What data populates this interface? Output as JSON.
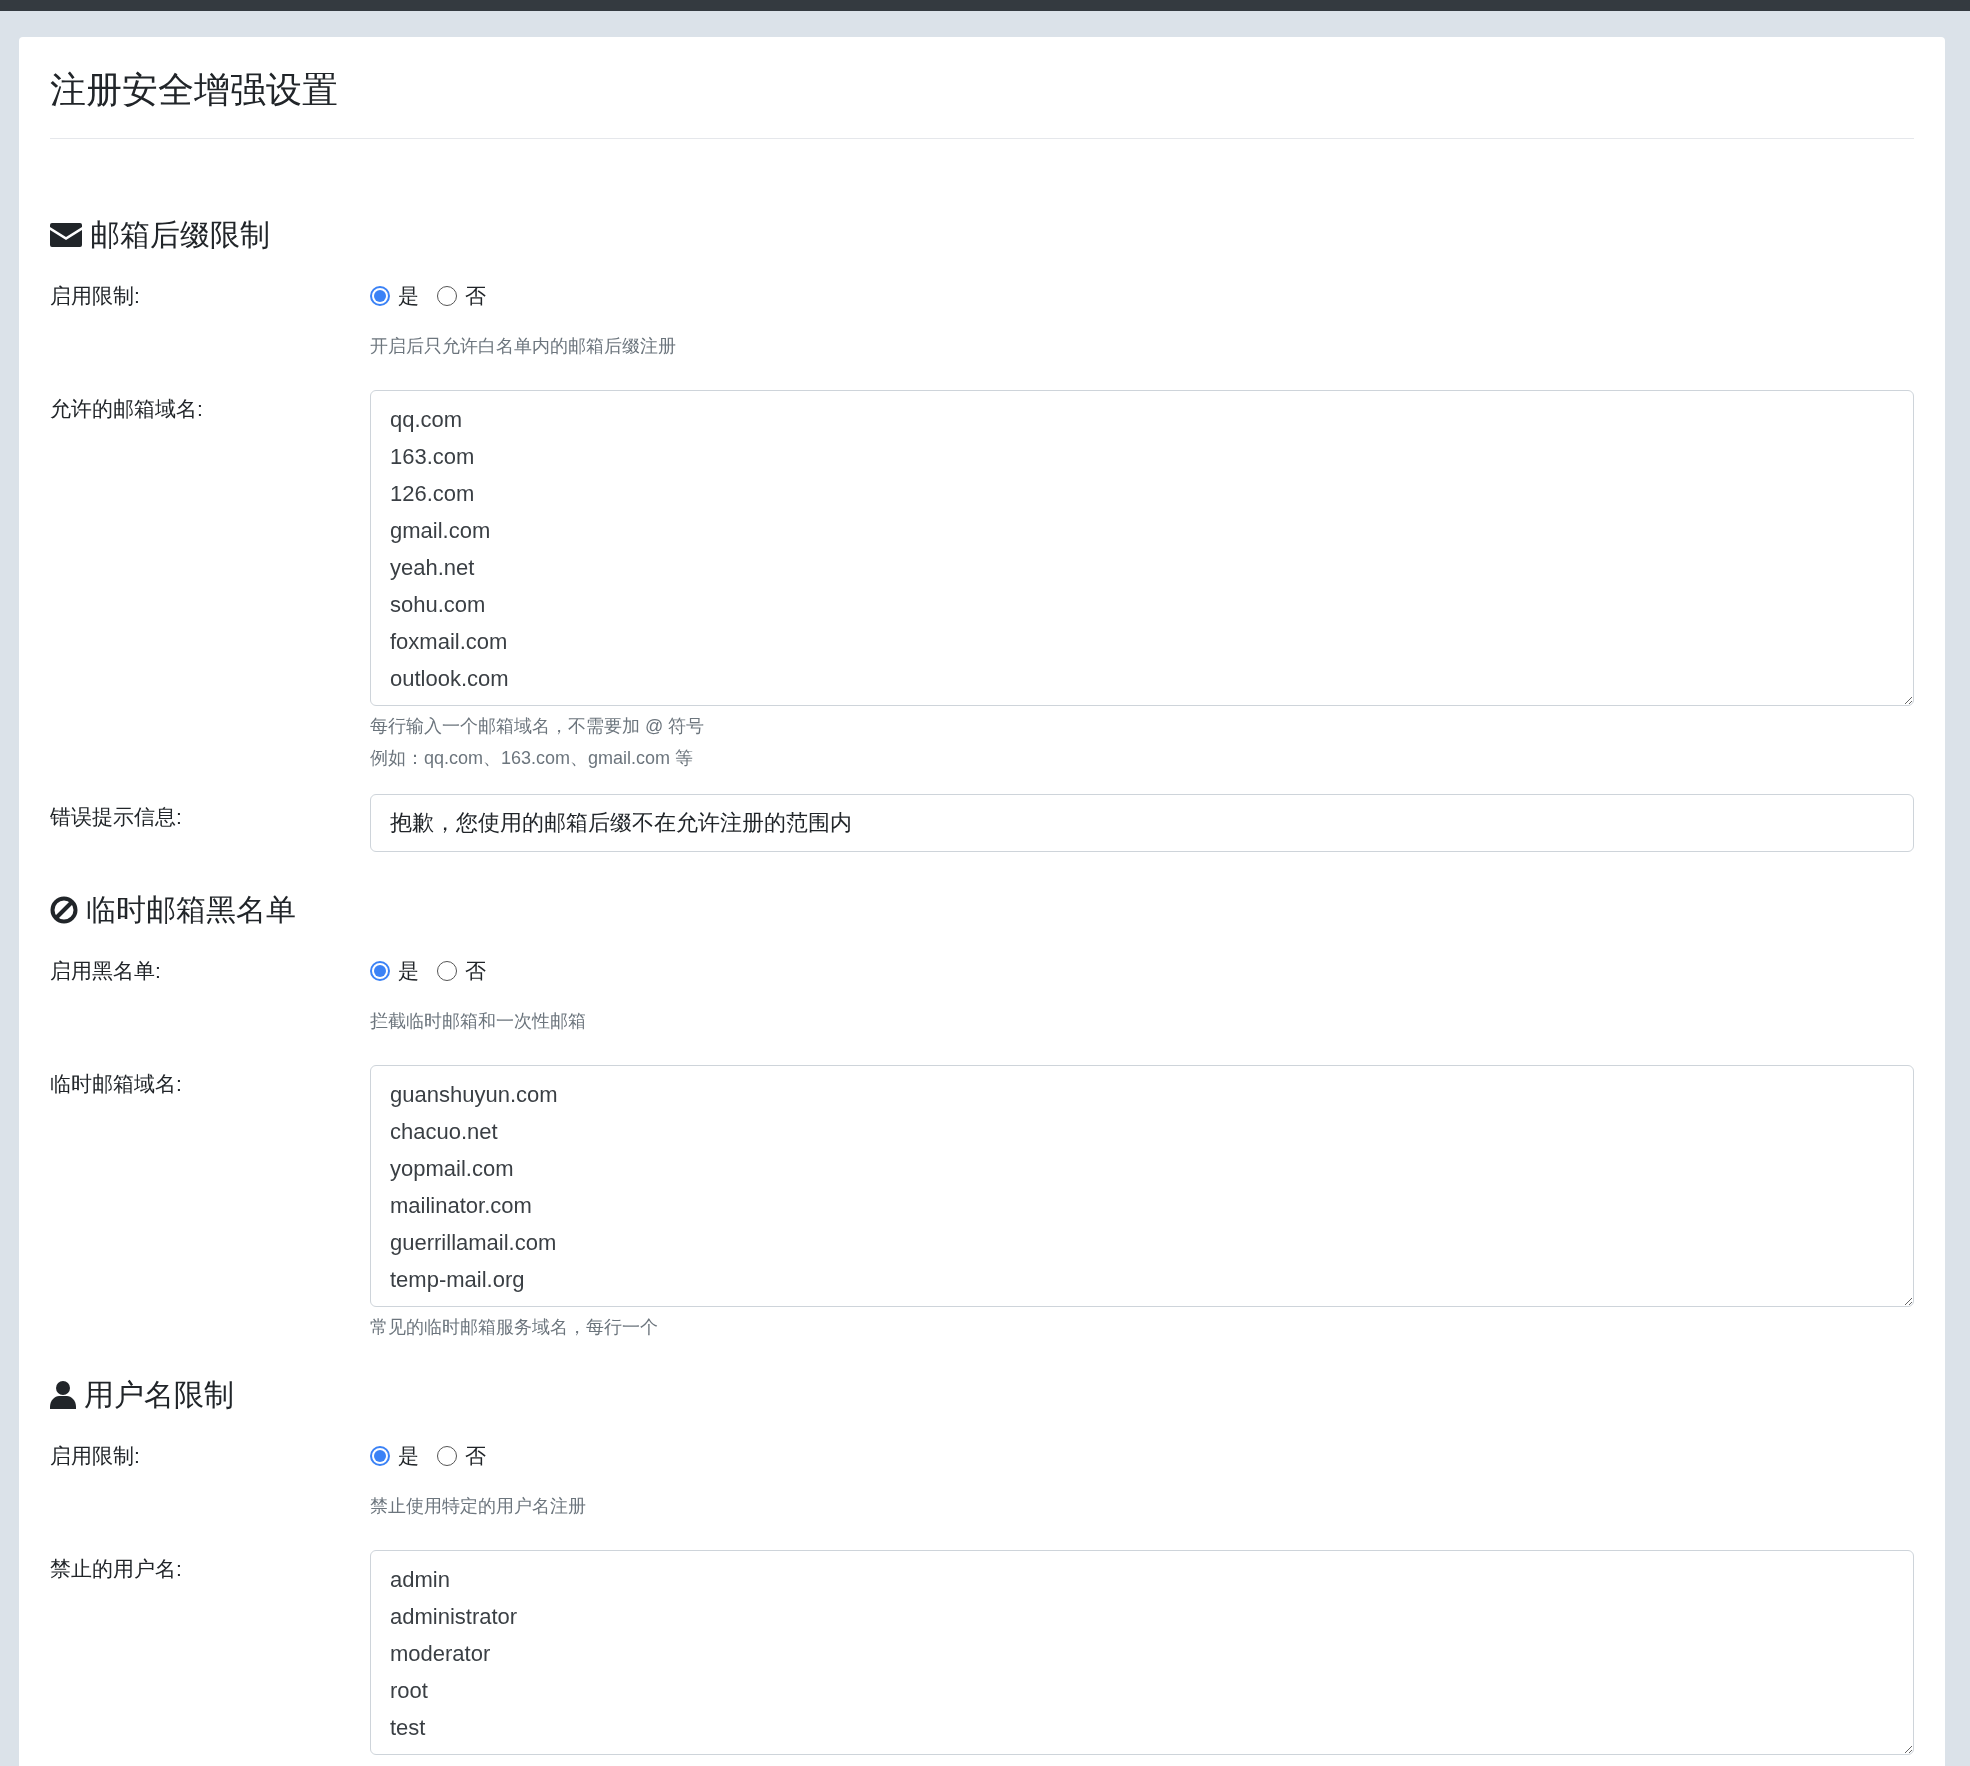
{
  "page_title": "注册安全增强设置",
  "sections": [
    {
      "heading": "邮箱后缀限制",
      "fields": [
        {
          "kind": "radio",
          "label": "启用限制:",
          "options": [
            {
              "label": "是",
              "selected": true
            },
            {
              "label": "否",
              "selected": false
            }
          ],
          "help": [
            "开启后只允许白名单内的邮箱后缀注册"
          ]
        },
        {
          "kind": "textarea",
          "label": "允许的邮箱域名:",
          "lines": [
            "qq.com",
            "163.com",
            "126.com",
            "gmail.com",
            "yeah.net",
            "sohu.com",
            "foxmail.com",
            "outlook.com"
          ],
          "help": [
            "每行输入一个邮箱域名，不需要加 @ 符号",
            "例如：qq.com、163.com、gmail.com 等"
          ]
        },
        {
          "kind": "input",
          "label": "错误提示信息:",
          "value": "抱歉，您使用的邮箱后缀不在允许注册的范围内"
        }
      ]
    },
    {
      "heading": "临时邮箱黑名单",
      "fields": [
        {
          "kind": "radio",
          "label": "启用黑名单:",
          "options": [
            {
              "label": "是",
              "selected": true
            },
            {
              "label": "否",
              "selected": false
            }
          ],
          "help": [
            "拦截临时邮箱和一次性邮箱"
          ]
        },
        {
          "kind": "textarea",
          "label": "临时邮箱域名:",
          "lines": [
            "guanshuyun.com",
            "chacuo.net",
            "yopmail.com",
            "mailinator.com",
            "guerrillamail.com",
            "temp-mail.org"
          ],
          "help": [
            "常见的临时邮箱服务域名，每行一个"
          ]
        }
      ]
    },
    {
      "heading": "用户名限制",
      "fields": [
        {
          "kind": "radio",
          "label": "启用限制:",
          "options": [
            {
              "label": "是",
              "selected": true
            },
            {
              "label": "否",
              "selected": false
            }
          ],
          "help": [
            "禁止使用特定的用户名注册"
          ]
        },
        {
          "kind": "textarea",
          "label": "禁止的用户名:",
          "lines": [
            "admin",
            "administrator",
            "moderator",
            "root",
            "test"
          ]
        }
      ]
    }
  ]
}
